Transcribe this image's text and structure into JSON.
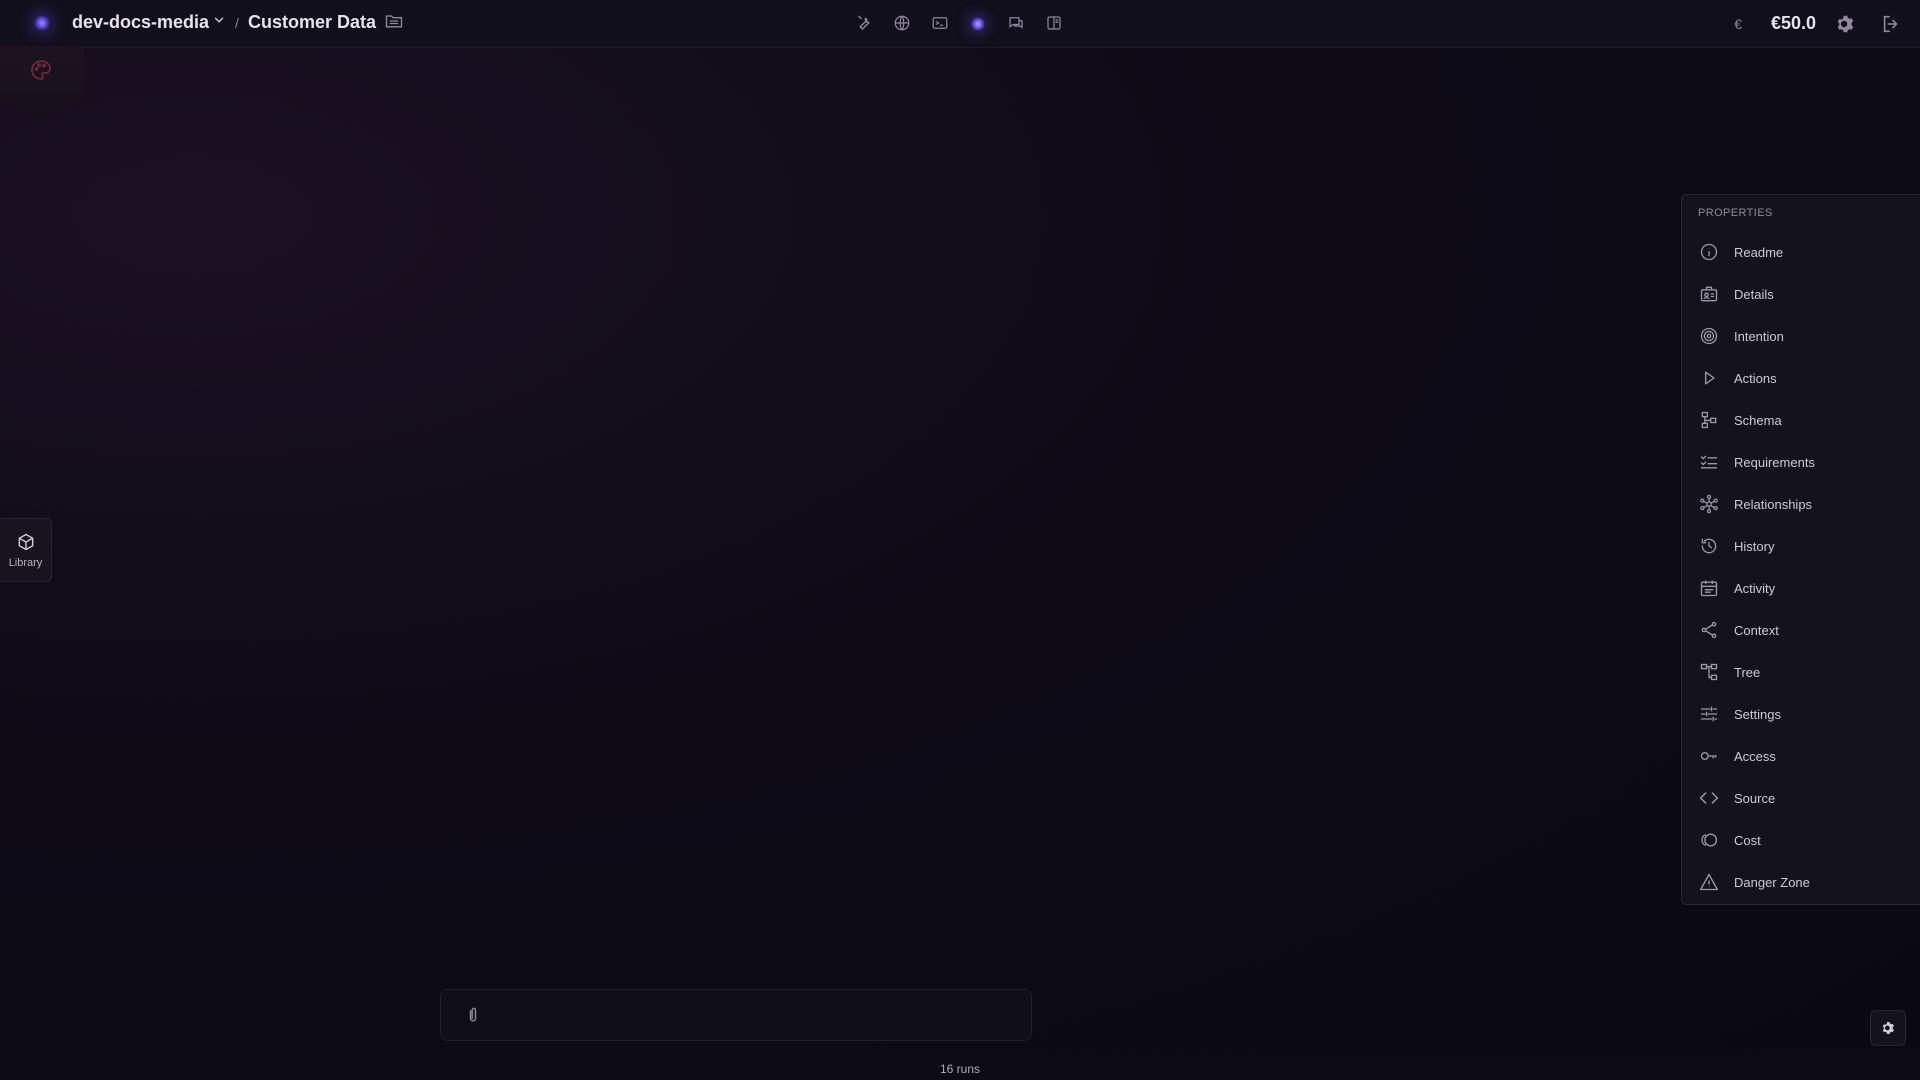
{
  "topbar": {
    "workspace": "dev-docs-media",
    "separator": "/",
    "page_title": "Customer Data",
    "tools": [
      "wrench-icon",
      "globe-icon",
      "terminal-icon",
      "agent-orb-icon",
      "chat-icon",
      "panel-icon"
    ],
    "credit_symbol": "€",
    "credit_value": "€50.0"
  },
  "library": {
    "label": "Library"
  },
  "properties": {
    "title": "PROPERTIES",
    "items": [
      {
        "label": "Readme",
        "icon": "info-icon"
      },
      {
        "label": "Details",
        "icon": "id-card-icon"
      },
      {
        "label": "Intention",
        "icon": "target-icon"
      },
      {
        "label": "Actions",
        "icon": "play-icon"
      },
      {
        "label": "Schema",
        "icon": "schema-icon"
      },
      {
        "label": "Requirements",
        "icon": "checklist-icon"
      },
      {
        "label": "Relationships",
        "icon": "network-icon"
      },
      {
        "label": "History",
        "icon": "history-icon"
      },
      {
        "label": "Activity",
        "icon": "calendar-icon"
      },
      {
        "label": "Context",
        "icon": "share-icon"
      },
      {
        "label": "Tree",
        "icon": "tree-icon"
      },
      {
        "label": "Settings",
        "icon": "sliders-icon"
      },
      {
        "label": "Access",
        "icon": "key-icon"
      },
      {
        "label": "Source",
        "icon": "code-icon"
      },
      {
        "label": "Cost",
        "icon": "coins-icon"
      },
      {
        "label": "Danger Zone",
        "icon": "warning-icon"
      }
    ]
  },
  "footer": {
    "runs": "16 runs"
  }
}
